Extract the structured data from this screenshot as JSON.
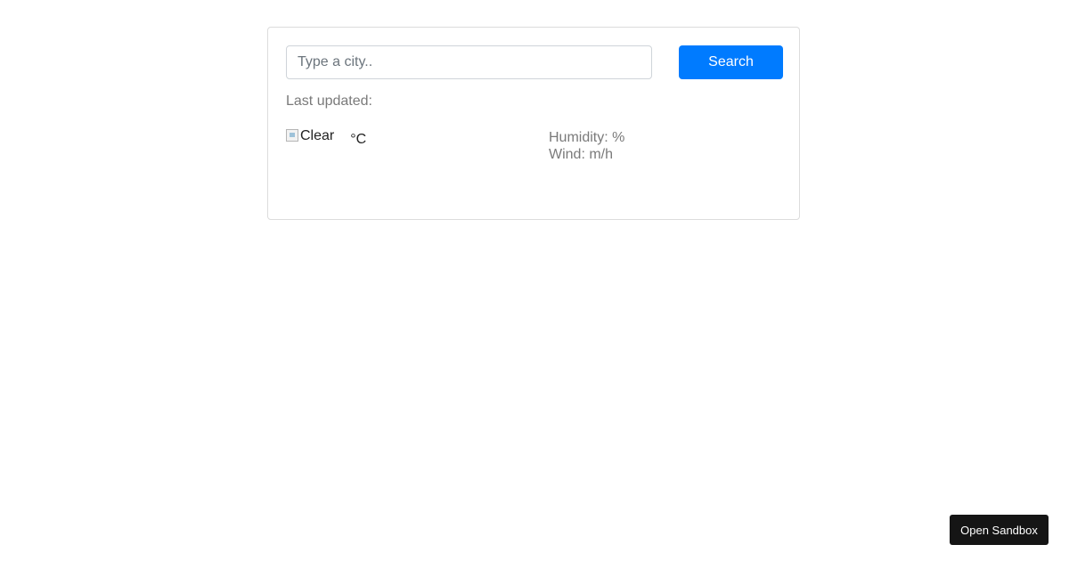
{
  "search": {
    "placeholder": "Type a city..",
    "value": "",
    "button_label": "Search"
  },
  "status": {
    "last_updated_label": "Last updated:"
  },
  "current": {
    "icon_alt": "Clear",
    "icon_name": "broken-image-icon",
    "temperature_unit": "°C"
  },
  "details": {
    "humidity_label": "Humidity: %",
    "wind_label": "Wind: m/h"
  },
  "footer": {
    "sandbox_label": "Open Sandbox"
  },
  "colors": {
    "accent": "#007bff",
    "sandbox_bg": "#151515",
    "muted_text": "#7a7a7a"
  }
}
